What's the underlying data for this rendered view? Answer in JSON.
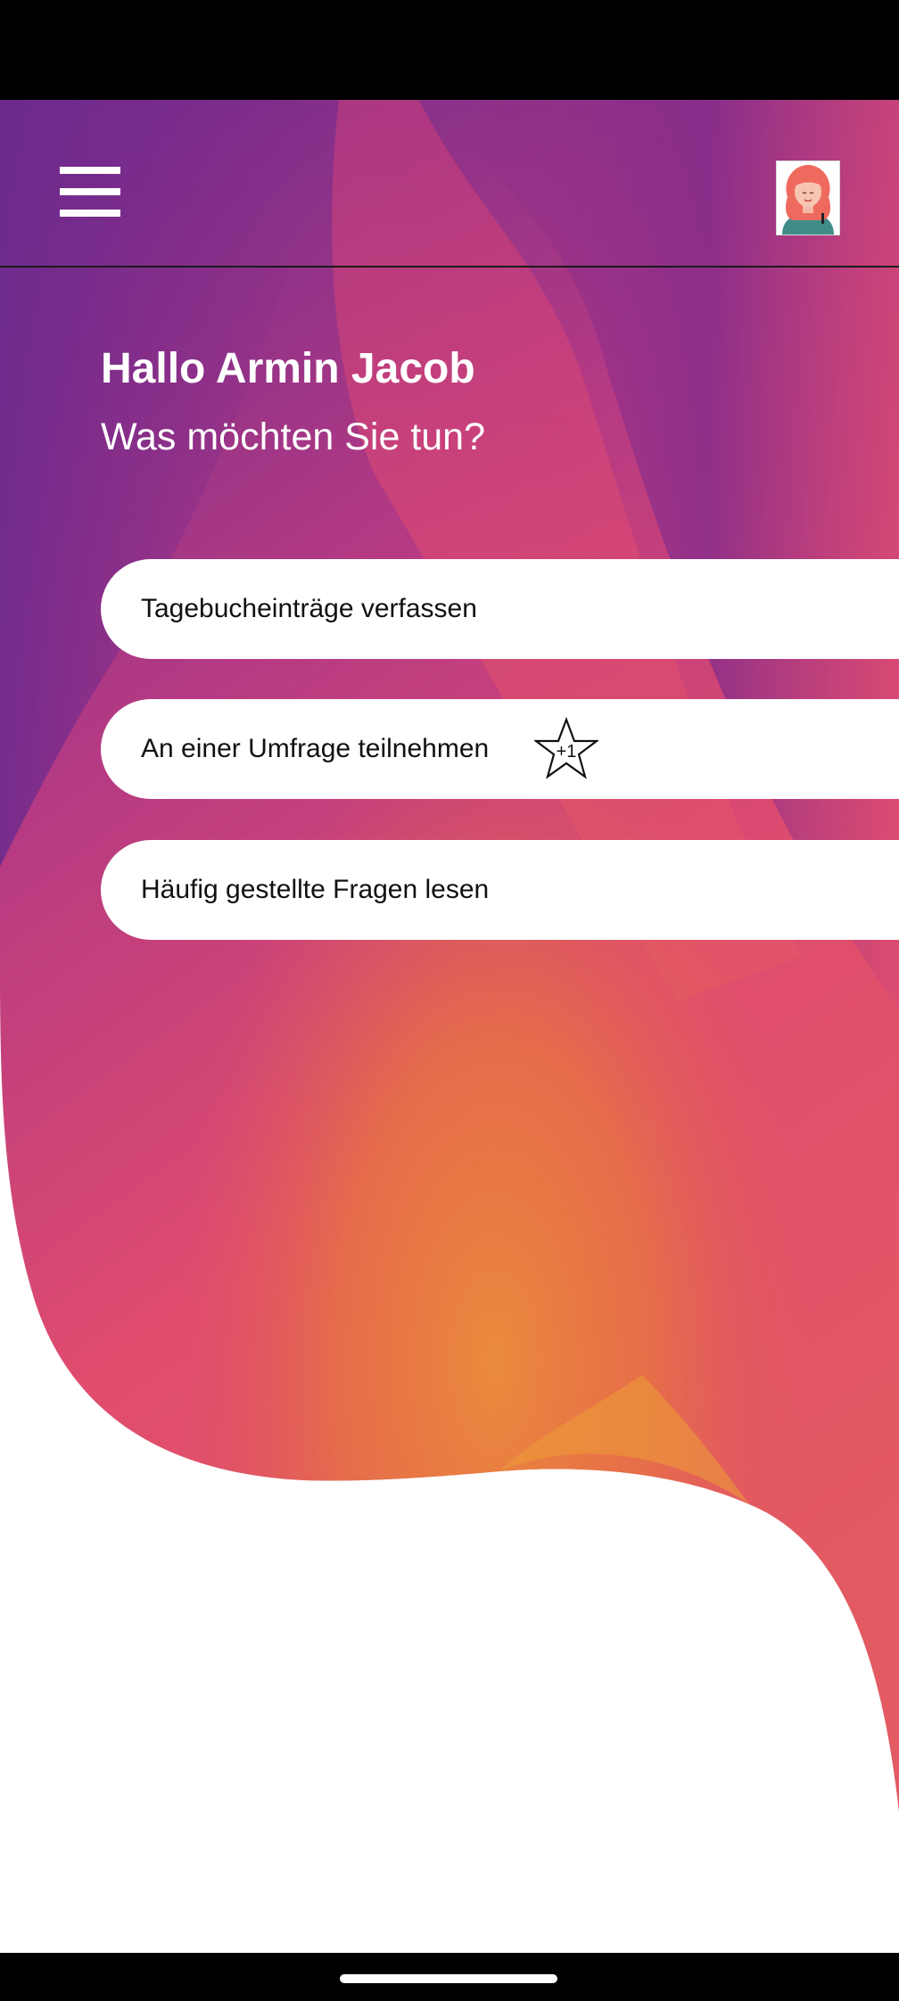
{
  "header": {
    "menu_icon": "hamburger-menu-icon",
    "avatar_icon": "user-avatar-icon"
  },
  "greeting": {
    "title": "Hallo Armin Jacob",
    "subtitle": "Was möchten Sie tun?"
  },
  "actions": [
    {
      "label": "Tagebucheinträge verfassen"
    },
    {
      "label": "An einer Umfrage teilnehmen",
      "badge": "+1",
      "badge_icon": "star-icon"
    },
    {
      "label": "Häufig gestellte Fragen lesen"
    }
  ],
  "colors": {
    "gradient_purple": "#7a2a8c",
    "gradient_magenta": "#c83d7a",
    "gradient_pink": "#e04a72",
    "gradient_orange": "#e8843c",
    "button_bg": "#ffffff",
    "text_on_gradient": "#ffffff"
  }
}
